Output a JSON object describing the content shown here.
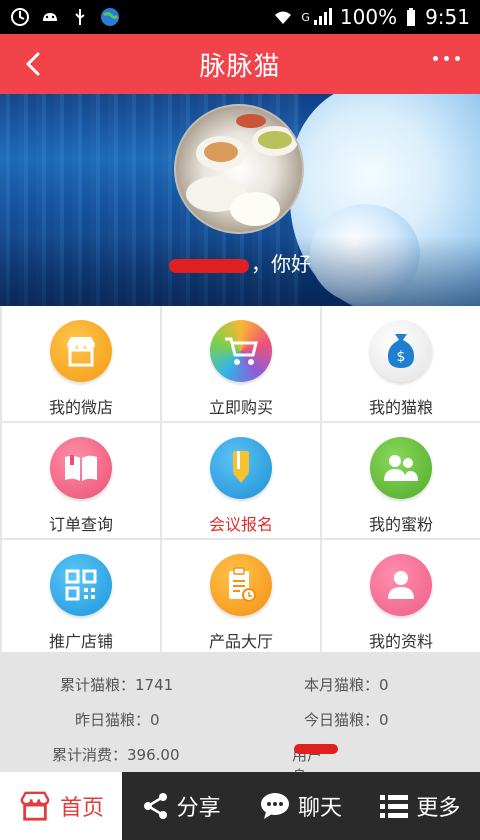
{
  "status_bar": {
    "signal_label": "G",
    "battery": "100%",
    "time": "9:51"
  },
  "header": {
    "title": "脉脉猫"
  },
  "profile": {
    "greeting_suffix": "，你好"
  },
  "menu": [
    {
      "label": "我的微店",
      "icon": "shop-icon",
      "color": "#f7a21b"
    },
    {
      "label": "立即购买",
      "icon": "cart-icon",
      "color": "#e84a8a"
    },
    {
      "label": "我的猫粮",
      "icon": "money-bag-icon",
      "color": "#eeeeee"
    },
    {
      "label": "订单查询",
      "icon": "book-icon",
      "color": "#f06d86"
    },
    {
      "label": "会议报名",
      "icon": "pen-icon",
      "color": "#2ea8e6"
    },
    {
      "label": "我的蜜粉",
      "icon": "group-icon",
      "color": "#69c23c"
    },
    {
      "label": "推广店铺",
      "icon": "qrcode-icon",
      "color": "#29a8e8"
    },
    {
      "label": "产品大厅",
      "icon": "clipboard-icon",
      "color": "#f9a825"
    },
    {
      "label": "我的资料",
      "icon": "person-icon",
      "color": "#f06690"
    }
  ],
  "stats": {
    "total_food": "累计猫粮：1741",
    "month_food": "本月猫粮：0",
    "yesterday_food": "昨日猫粮：0",
    "today_food": "今日猫粮：0",
    "total_spend": "累计消费：396.00",
    "user_identity": "用户身份："
  },
  "bottom_nav": {
    "home": "首页",
    "share": "分享",
    "chat": "聊天",
    "more": "更多"
  },
  "colors": {
    "brand_red": "#f2424a",
    "nav_dark": "#2a2a2a",
    "highlight_red": "#e22c2c"
  }
}
